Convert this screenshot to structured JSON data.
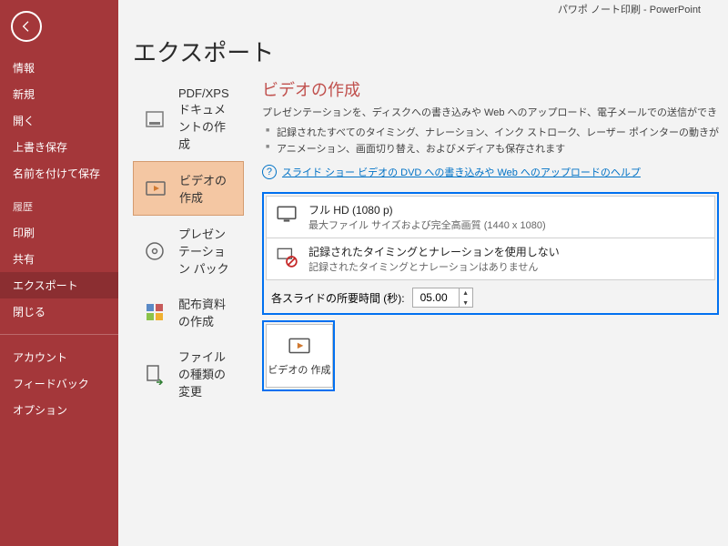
{
  "window": {
    "title": "パワポ ノート印刷 - PowerPoint"
  },
  "page": {
    "title": "エクスポート"
  },
  "sidebar": {
    "items": [
      "情報",
      "新規",
      "開く",
      "上書き保存",
      "名前を付けて保存"
    ],
    "history_label": "履歴",
    "items2": [
      "印刷",
      "共有",
      "エクスポート",
      "閉じる"
    ],
    "items3": [
      "アカウント",
      "フィードバック",
      "オプション"
    ],
    "selected": "エクスポート"
  },
  "export_options": [
    {
      "label": "PDF/XPS ドキュメントの作成",
      "icon": "pdf"
    },
    {
      "label": "ビデオの作成",
      "icon": "video",
      "selected": true
    },
    {
      "label": "プレゼンテーション パック",
      "icon": "cd"
    },
    {
      "label": "配布資料の作成",
      "icon": "handout"
    },
    {
      "label": "ファイルの種類の変更",
      "icon": "filetype"
    }
  ],
  "video": {
    "title": "ビデオの作成",
    "subtitle": "プレゼンテーションを、ディスクへの書き込みや Web へのアップロード、電子メールでの送信ができ",
    "bullets": [
      "記録されたすべてのタイミング、ナレーション、インク ストローク、レーザー ポインターの動きが",
      "アニメーション、画面切り替え、およびメディアも保存されます"
    ],
    "help_link": "スライド ショー ビデオの DVD への書き込みや Web へのアップロードのヘルプ",
    "quality": {
      "title": "フル HD (1080 p)",
      "desc": "最大ファイル サイズおよび完全高画質 (1440 x 1080)"
    },
    "timing": {
      "title": "記録されたタイミングとナレーションを使用しない",
      "desc": "記録されたタイミングとナレーションはありません"
    },
    "duration_label": "各スライドの所要時間 (秒):",
    "duration_value": "05.00",
    "create_button": "ビデオの\n作成"
  }
}
